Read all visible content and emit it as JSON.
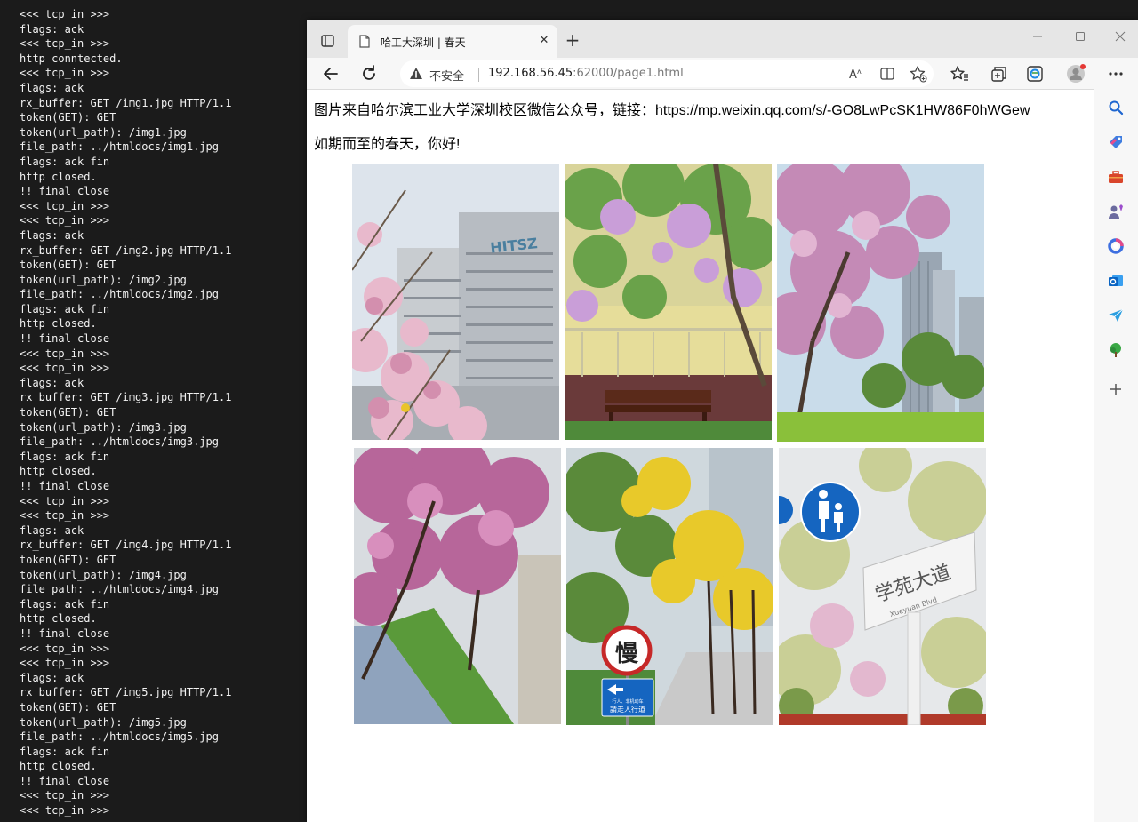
{
  "terminal": {
    "lines": [
      "<<< tcp_in >>>",
      "flags: ack",
      "<<< tcp_in >>>",
      "http conntected.",
      "<<< tcp_in >>>",
      "flags: ack",
      "rx_buffer: GET /img1.jpg HTTP/1.1",
      "token(GET): GET",
      "token(url_path): /img1.jpg",
      "file_path: ../htmldocs/img1.jpg",
      "flags: ack fin",
      "http closed.",
      "!! final close",
      "<<< tcp_in >>>",
      "<<< tcp_in >>>",
      "flags: ack",
      "rx_buffer: GET /img2.jpg HTTP/1.1",
      "token(GET): GET",
      "token(url_path): /img2.jpg",
      "file_path: ../htmldocs/img2.jpg",
      "flags: ack fin",
      "http closed.",
      "!! final close",
      "<<< tcp_in >>>",
      "<<< tcp_in >>>",
      "flags: ack",
      "rx_buffer: GET /img3.jpg HTTP/1.1",
      "token(GET): GET",
      "token(url_path): /img3.jpg",
      "file_path: ../htmldocs/img3.jpg",
      "flags: ack fin",
      "http closed.",
      "!! final close",
      "<<< tcp_in >>>",
      "<<< tcp_in >>>",
      "flags: ack",
      "rx_buffer: GET /img4.jpg HTTP/1.1",
      "token(GET): GET",
      "token(url_path): /img4.jpg",
      "file_path: ../htmldocs/img4.jpg",
      "flags: ack fin",
      "http closed.",
      "!! final close",
      "<<< tcp_in >>>",
      "<<< tcp_in >>>",
      "flags: ack",
      "rx_buffer: GET /img5.jpg HTTP/1.1",
      "token(GET): GET",
      "token(url_path): /img5.jpg",
      "file_path: ../htmldocs/img5.jpg",
      "flags: ack fin",
      "http closed.",
      "!! final close",
      "<<< tcp_in >>>",
      "<<< tcp_in >>>"
    ]
  },
  "browser": {
    "tab_title": "哈工大深圳 | 春天",
    "tab_close": "✕",
    "new_tab": "+",
    "address": {
      "security_label": "不安全",
      "host": "192.168.56.45",
      "rest": ":62000/page1.html"
    },
    "icons": {
      "back": "back-arrow-icon",
      "reload": "reload-icon",
      "read_aloud": "read-aloud-icon",
      "split": "split-screen-icon",
      "favorite": "add-favorite-icon",
      "favorites": "favorites-icon",
      "collections": "collections-icon",
      "edge": "edge-icon",
      "profile": "profile-icon",
      "more": "more-icon"
    },
    "sidebar_icons": [
      "search-icon",
      "tag-icon",
      "toolbox-icon",
      "people-icon",
      "office-icon",
      "outlook-icon",
      "send-icon",
      "tree-icon",
      "add-icon"
    ]
  },
  "page": {
    "source_line": "图片来自哈尔滨工业大学深圳校区微信公众号，链接：https://mp.weixin.qq.com/s/-GO8LwPcSK1HW86F0hWGew",
    "greeting": "如期而至的春天，你好!"
  },
  "sign_text": {
    "slow": "慢",
    "road": "学苑大道",
    "road_en": "Xueyuan Blvd",
    "ped_small": "行人、非机动车",
    "ped_big": "請走人行道"
  },
  "colors": {
    "terminal_bg": "#1b1b1b",
    "terminal_fg": "#f2f2f2",
    "warning": "#444444",
    "sign_blue": "#1565c0",
    "sign_red": "#c62828"
  }
}
